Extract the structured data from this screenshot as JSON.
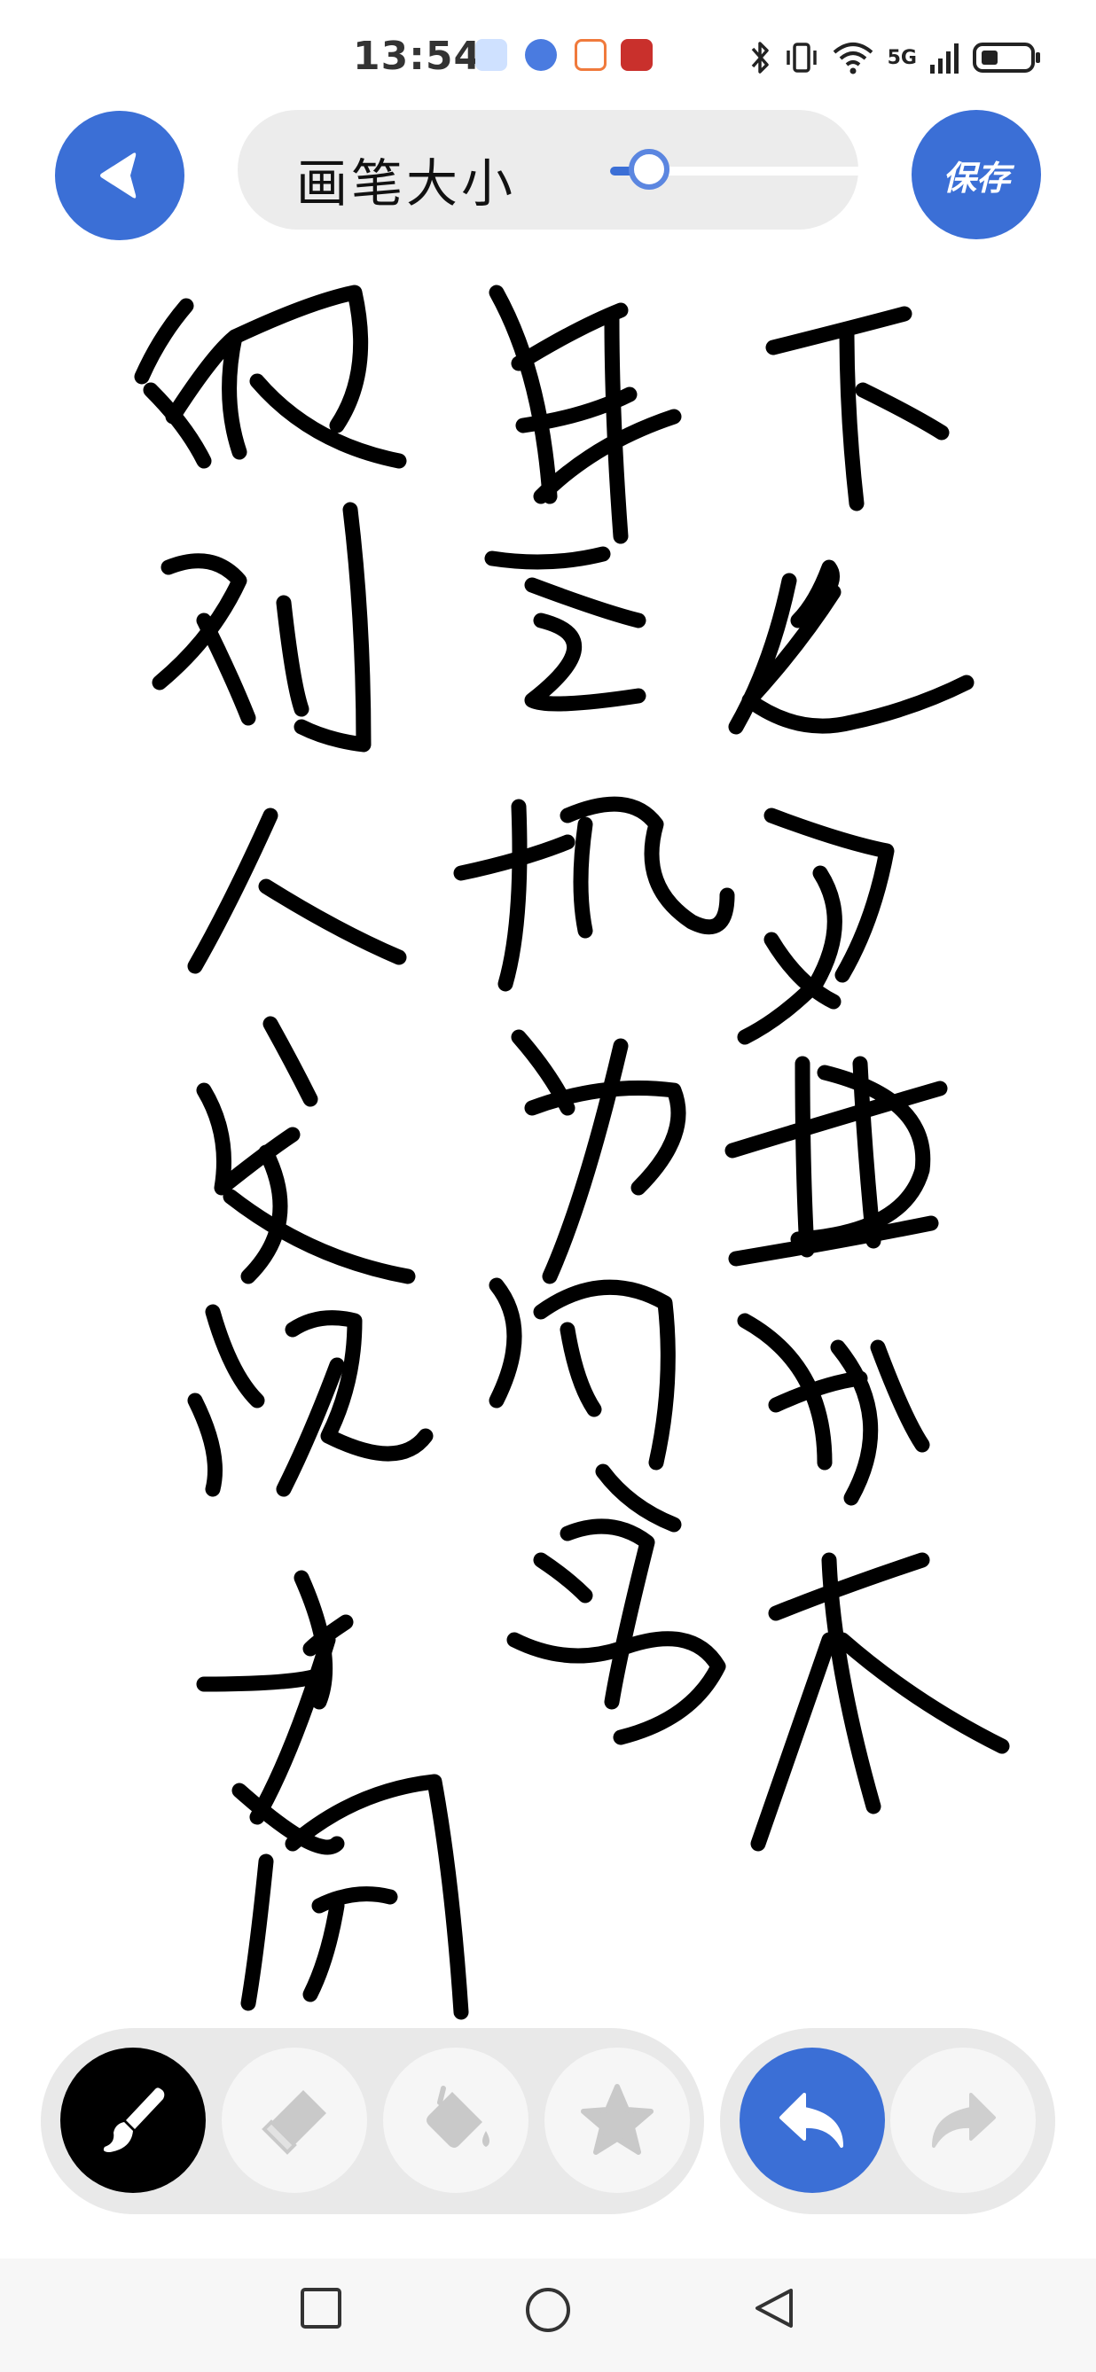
{
  "status_bar": {
    "time": "13:54",
    "network": "5G",
    "icons": [
      "notification-app-icon",
      "notification-app-icon",
      "notification-app-icon",
      "notification-app-icon",
      "bluetooth-icon",
      "vibrate-icon",
      "wifi-icon",
      "signal-icon",
      "battery-icon"
    ]
  },
  "toolbar": {
    "brush_size_label": "画笔大小",
    "brush_size_fraction": 0.15,
    "save_label": "保存",
    "back_icon": "back-arrow-icon"
  },
  "canvas": {
    "handwritten_text": "下过雪无痕来 封之地为何易 被别人发现占用"
  },
  "tools": [
    {
      "name": "brush",
      "icon": "brush-icon",
      "active": true
    },
    {
      "name": "eraser",
      "icon": "eraser-icon",
      "active": false
    },
    {
      "name": "fill",
      "icon": "paint-bucket-icon",
      "active": false
    },
    {
      "name": "sticker",
      "icon": "star-icon",
      "active": false
    }
  ],
  "history": [
    {
      "name": "undo",
      "icon": "undo-icon",
      "enabled": true
    },
    {
      "name": "redo",
      "icon": "redo-icon",
      "enabled": false
    }
  ],
  "colors": {
    "accent": "#3b6fd6",
    "ink": "#000000",
    "pill": "#ececec"
  },
  "navigation": [
    "recent-apps-icon",
    "home-icon",
    "back-icon"
  ]
}
